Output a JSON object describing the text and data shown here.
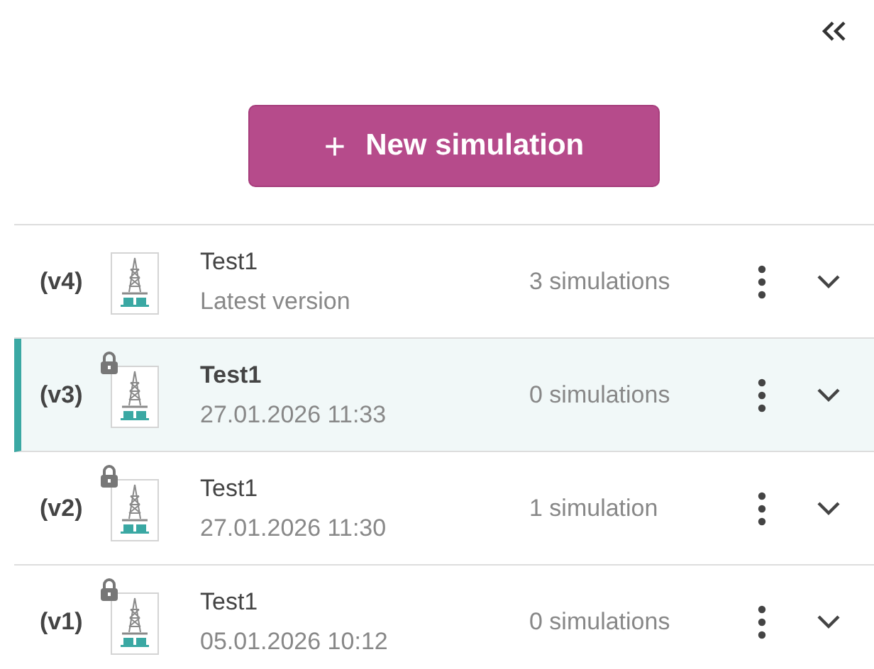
{
  "new_button": {
    "label": "New simulation",
    "icon": "+"
  },
  "versions": [
    {
      "version": "(v4)",
      "title": "Test1",
      "subtitle": "Latest version",
      "count": "3 simulations",
      "locked": false,
      "selected": false
    },
    {
      "version": "(v3)",
      "title": "Test1",
      "subtitle": "27.01.2026 11:33",
      "count": "0 simulations",
      "locked": true,
      "selected": true
    },
    {
      "version": "(v2)",
      "title": "Test1",
      "subtitle": "27.01.2026 11:30",
      "count": "1 simulation",
      "locked": true,
      "selected": false
    },
    {
      "version": "(v1)",
      "title": "Test1",
      "subtitle": "05.01.2026 10:12",
      "count": "0 simulations",
      "locked": true,
      "selected": false
    }
  ]
}
